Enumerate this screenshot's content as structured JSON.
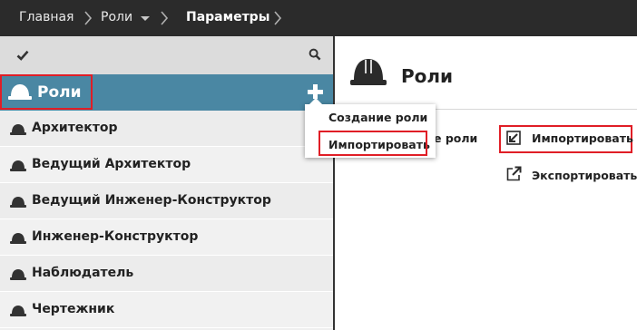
{
  "breadcrumb": {
    "items": [
      {
        "label": "Главная"
      },
      {
        "label": "Роли"
      },
      {
        "label": "Параметры"
      }
    ]
  },
  "sidebar": {
    "toolbar": {
      "check_icon": "check-icon",
      "search_icon": "search-icon"
    },
    "header": {
      "title": "Роли",
      "icon": "hard-hat-icon",
      "add_icon": "plus-icon"
    },
    "items": [
      {
        "label": "Архитектор"
      },
      {
        "label": "Ведущий Архитектор"
      },
      {
        "label": "Ведущий Инженер-Конструктор"
      },
      {
        "label": "Инженер-Конструктор"
      },
      {
        "label": "Наблюдатель"
      },
      {
        "label": "Чертежник"
      }
    ]
  },
  "popup_menu": {
    "items": [
      {
        "label": "Создание роли"
      },
      {
        "label": "Импортировать"
      }
    ]
  },
  "main": {
    "title": "Роли",
    "partial_link": "е роли",
    "import_label": "Импортировать",
    "export_label": "Экспортировать"
  },
  "colors": {
    "topbar": "#2b2b2b",
    "header_accent": "#4a87a3",
    "highlight_border": "#e01e26"
  }
}
